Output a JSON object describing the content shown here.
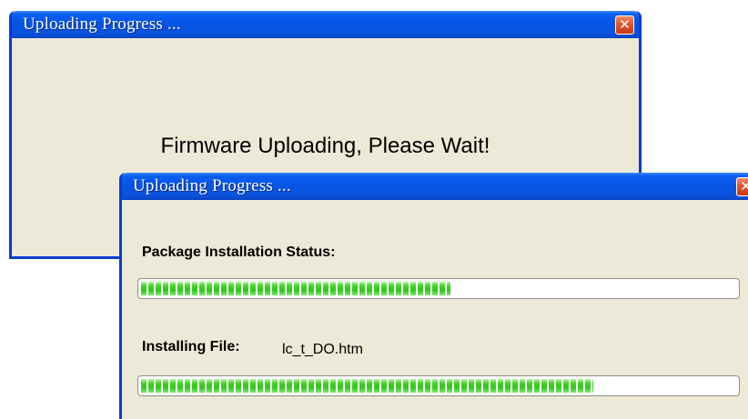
{
  "back_window": {
    "title": "Uploading Progress ...",
    "message": "Firmware Uploading, Please Wait!"
  },
  "front_window": {
    "title": "Uploading Progress ...",
    "package_status_label": "Package Installation Status:",
    "package_progress_percent": 52,
    "installing_file_label": "Installing File:",
    "installing_file_name": "lc_t_DO.htm",
    "file_progress_percent": 76
  },
  "icons": {
    "close": "close-icon"
  },
  "colors": {
    "title_bar": "#0655e4",
    "window_bg": "#ece9d8",
    "progress_fill": "#2fc41a",
    "close_button": "#e0552f"
  }
}
